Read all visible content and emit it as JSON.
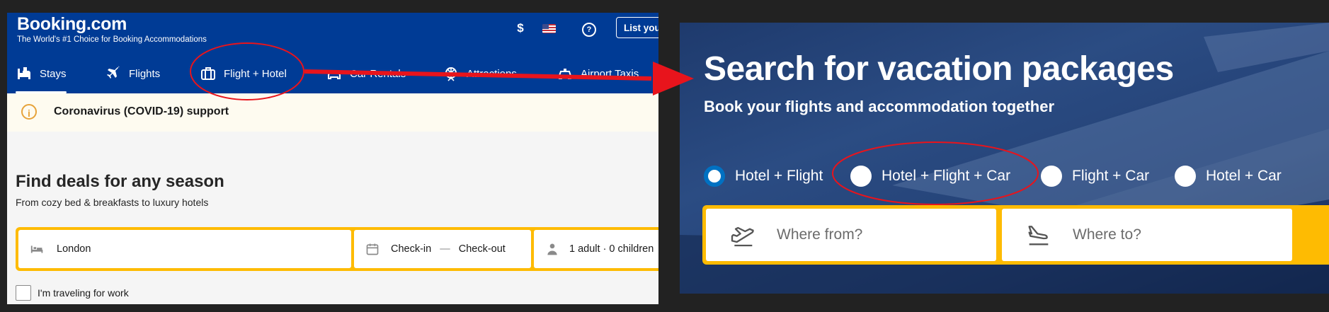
{
  "left_panel": {
    "header": {
      "logo": "Booking.com",
      "tagline": "The World's #1 Choice for Booking Accommodations",
      "currency": "$",
      "help_glyph": "?",
      "list_property": "List your"
    },
    "nav": [
      {
        "label": "Stays",
        "icon": "bed-icon",
        "active": true
      },
      {
        "label": "Flights",
        "icon": "plane-icon",
        "active": false
      },
      {
        "label": "Flight + Hotel",
        "icon": "suitcase-icon",
        "active": false
      },
      {
        "label": "Car Rentals",
        "icon": "car-icon",
        "active": false
      },
      {
        "label": "Attractions",
        "icon": "ferris-wheel-icon",
        "active": false
      },
      {
        "label": "Airport Taxis",
        "icon": "taxi-icon",
        "active": false
      }
    ],
    "covid_banner": {
      "icon_glyph": "i",
      "text": "Coronavirus (COVID-19) support"
    },
    "hero": {
      "title": "Find deals for any season",
      "subtitle": "From cozy bed & breakfasts to luxury hotels"
    },
    "search": {
      "destination": "London",
      "check_in": "Check-in",
      "dash": "—",
      "check_out": "Check-out",
      "guests": "1 adult  ·  0 children"
    },
    "work_travel_label": "I'm traveling for work"
  },
  "right_panel": {
    "title": "Search for vacation packages",
    "subtitle": "Book your flights and accommodation together",
    "package_options": [
      {
        "label": "Hotel + Flight",
        "selected": true
      },
      {
        "label": "Hotel + Flight + Car",
        "selected": false
      },
      {
        "label": "Flight + Car",
        "selected": false
      },
      {
        "label": "Hotel + Car",
        "selected": false
      }
    ],
    "from_placeholder": "Where from?",
    "to_placeholder": "Where to?"
  },
  "colors": {
    "brand_blue": "#003b95",
    "search_yellow": "#febb02",
    "annotation_red": "#e8141c",
    "radio_blue": "#0071c2"
  }
}
